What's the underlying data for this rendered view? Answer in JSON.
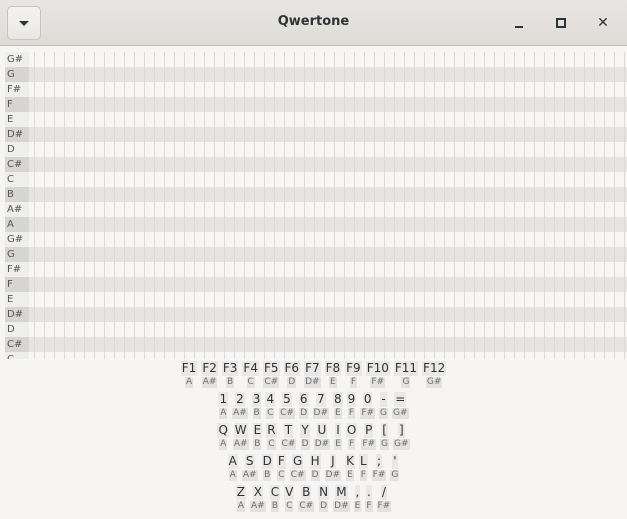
{
  "window": {
    "title": "Qwertone"
  },
  "piano_roll": {
    "notes": [
      "G#",
      "G",
      "F#",
      "F",
      "E",
      "D#",
      "D",
      "C#",
      "C",
      "B",
      "A#",
      "A",
      "G#",
      "G",
      "F#",
      "F",
      "E",
      "D#",
      "D",
      "C#",
      "C"
    ]
  },
  "keyboard": {
    "rows": [
      {
        "keys": [
          {
            "key": "F1",
            "note": "A"
          },
          {
            "key": "F2",
            "note": "A#"
          },
          {
            "key": "F3",
            "note": "B"
          },
          {
            "key": "F4",
            "note": "C"
          },
          {
            "key": "F5",
            "note": "C#"
          },
          {
            "key": "F6",
            "note": "D"
          },
          {
            "key": "F7",
            "note": "D#"
          },
          {
            "key": "F8",
            "note": "E"
          },
          {
            "key": "F9",
            "note": "F"
          },
          {
            "key": "F10",
            "note": "F#"
          },
          {
            "key": "F11",
            "note": "G"
          },
          {
            "key": "F12",
            "note": "G#"
          }
        ]
      },
      {
        "keys": [
          {
            "key": "1",
            "note": "A"
          },
          {
            "key": "2",
            "note": "A#"
          },
          {
            "key": "3",
            "note": "B"
          },
          {
            "key": "4",
            "note": "C"
          },
          {
            "key": "5",
            "note": "C#"
          },
          {
            "key": "6",
            "note": "D"
          },
          {
            "key": "7",
            "note": "D#"
          },
          {
            "key": "8",
            "note": "E"
          },
          {
            "key": "9",
            "note": "F"
          },
          {
            "key": "0",
            "note": "F#"
          },
          {
            "key": "-",
            "note": "G"
          },
          {
            "key": "=",
            "note": "G#"
          }
        ]
      },
      {
        "keys": [
          {
            "key": "Q",
            "note": "A"
          },
          {
            "key": "W",
            "note": "A#"
          },
          {
            "key": "E",
            "note": "B"
          },
          {
            "key": "R",
            "note": "C"
          },
          {
            "key": "T",
            "note": "C#"
          },
          {
            "key": "Y",
            "note": "D"
          },
          {
            "key": "U",
            "note": "D#"
          },
          {
            "key": "I",
            "note": "E"
          },
          {
            "key": "O",
            "note": "F"
          },
          {
            "key": "P",
            "note": "F#"
          },
          {
            "key": "[",
            "note": "G"
          },
          {
            "key": "]",
            "note": "G#"
          }
        ]
      },
      {
        "keys": [
          {
            "key": "A",
            "note": "A"
          },
          {
            "key": "S",
            "note": "A#"
          },
          {
            "key": "D",
            "note": "B"
          },
          {
            "key": "F",
            "note": "C"
          },
          {
            "key": "G",
            "note": "C#"
          },
          {
            "key": "H",
            "note": "D"
          },
          {
            "key": "J",
            "note": "D#"
          },
          {
            "key": "K",
            "note": "E"
          },
          {
            "key": "L",
            "note": "F"
          },
          {
            "key": ";",
            "note": "F#"
          },
          {
            "key": "'",
            "note": "G"
          }
        ]
      },
      {
        "keys": [
          {
            "key": "Z",
            "note": "A"
          },
          {
            "key": "X",
            "note": "A#"
          },
          {
            "key": "C",
            "note": "B"
          },
          {
            "key": "V",
            "note": "C"
          },
          {
            "key": "B",
            "note": "C#"
          },
          {
            "key": "N",
            "note": "D"
          },
          {
            "key": "M",
            "note": "D#"
          },
          {
            "key": ",",
            "note": "E"
          },
          {
            "key": ".",
            "note": "F"
          },
          {
            "key": "/",
            "note": "F#"
          }
        ]
      }
    ]
  }
}
